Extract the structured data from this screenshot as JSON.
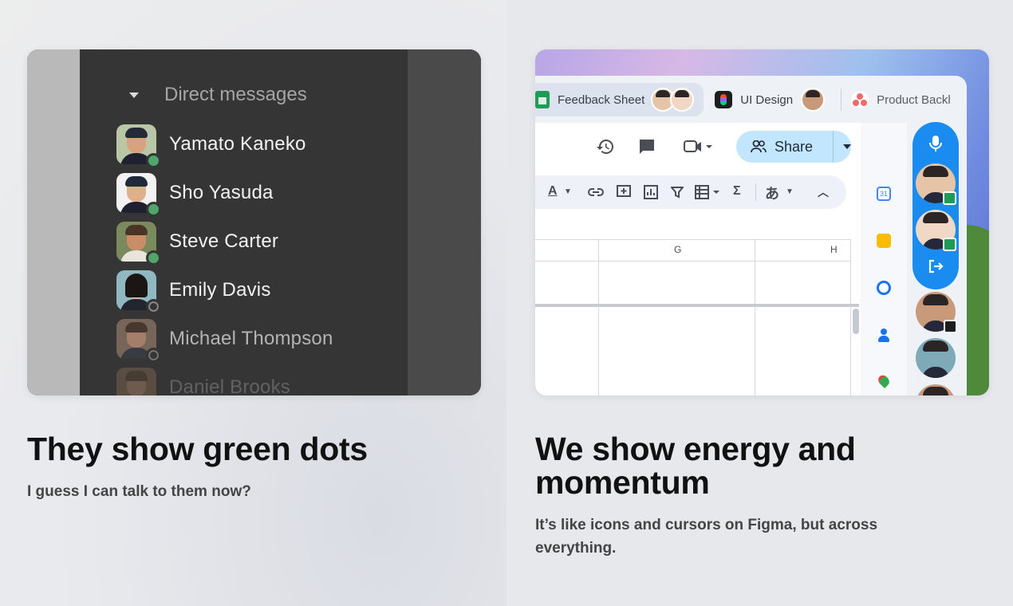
{
  "left": {
    "dm_header": "Direct messages",
    "contacts": [
      {
        "name": "Yamato Kaneko",
        "status": "online"
      },
      {
        "name": "Sho Yasuda",
        "status": "online"
      },
      {
        "name": "Steve Carter",
        "status": "online"
      },
      {
        "name": "Emily Davis",
        "status": "offline"
      },
      {
        "name": "Michael Thompson",
        "status": "offline"
      },
      {
        "name": "Daniel Brooks",
        "status": "unknown"
      }
    ],
    "headline": "They show green dots",
    "subtext": "I guess I can talk to them now?"
  },
  "right": {
    "tabs": [
      {
        "label": "Feedback Sheet",
        "icon": "google-sheets-icon"
      },
      {
        "label": "UI Design",
        "icon": "figma-icon"
      },
      {
        "label": "Product Backl",
        "icon": "asana-icon"
      }
    ],
    "share_label": "Share",
    "columns": [
      "G",
      "H"
    ],
    "side_icons": [
      "calendar-icon",
      "keep-icon",
      "tasks-icon",
      "contacts-icon",
      "maps-icon"
    ],
    "calendar_day": "31",
    "toolbar_glyphs": {
      "text_color": "A",
      "sum": "Σ",
      "input": "あ"
    },
    "headline": "We show energy and momentum",
    "subtext": "It’s like icons and cursors on Figma, but across everything."
  },
  "colors": {
    "online": "#4fa56a",
    "presence_blue": "#1a8cf0",
    "share_bg": "#c3e6ff",
    "dark_panel": "#353535"
  }
}
